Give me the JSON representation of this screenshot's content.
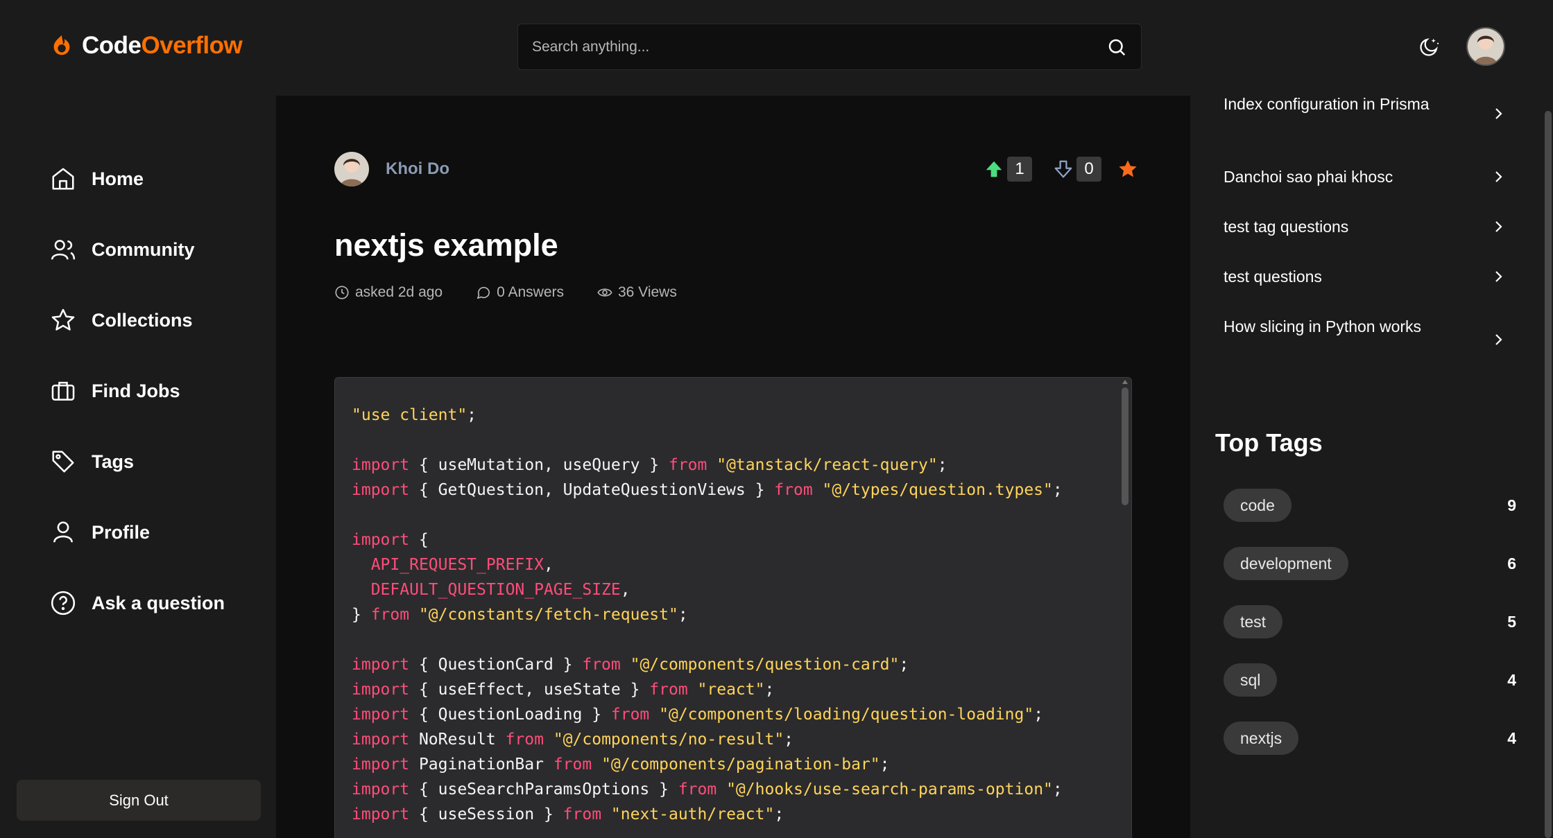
{
  "brand": {
    "name_part1": "Code",
    "name_part2": "Overflow",
    "accent": "#ff7000"
  },
  "search": {
    "placeholder": "Search anything..."
  },
  "sidebar": {
    "items": [
      {
        "label": "Home",
        "icon": "home-icon"
      },
      {
        "label": "Community",
        "icon": "users-icon"
      },
      {
        "label": "Collections",
        "icon": "star-icon"
      },
      {
        "label": "Find Jobs",
        "icon": "briefcase-icon"
      },
      {
        "label": "Tags",
        "icon": "tag-icon"
      },
      {
        "label": "Profile",
        "icon": "user-icon"
      },
      {
        "label": "Ask a question",
        "icon": "question-icon"
      }
    ],
    "signout_label": "Sign Out"
  },
  "question": {
    "author": "Khoi Do",
    "upvotes": "1",
    "downvotes": "0",
    "title": "nextjs example",
    "asked": "asked 2d ago",
    "answers": "0 Answers",
    "views": "36 Views",
    "code_lines": [
      "\"use client\";",
      "",
      "import { useMutation, useQuery } from \"@tanstack/react-query\";",
      "import { GetQuestion, UpdateQuestionViews } from \"@/types/question.types\";",
      "",
      "import {",
      "  API_REQUEST_PREFIX,",
      "  DEFAULT_QUESTION_PAGE_SIZE,",
      "} from \"@/constants/fetch-request\";",
      "",
      "import { QuestionCard } from \"@/components/question-card\";",
      "import { useEffect, useState } from \"react\";",
      "import { QuestionLoading } from \"@/components/loading/question-loading\";",
      "import NoResult from \"@/components/no-result\";",
      "import PaginationBar from \"@/components/pagination-bar\";",
      "import { useSearchParamsOptions } from \"@/hooks/use-search-params-option\";",
      "import { useSession } from \"next-auth/react\";"
    ]
  },
  "hot_questions": [
    "Index configuration in Prisma",
    "Danchoi sao phai khosc",
    "test tag questions",
    "test questions",
    "How slicing in Python works"
  ],
  "top_tags": {
    "title": "Top Tags",
    "items": [
      {
        "name": "code",
        "count": "9"
      },
      {
        "name": "development",
        "count": "6"
      },
      {
        "name": "test",
        "count": "5"
      },
      {
        "name": "sql",
        "count": "4"
      },
      {
        "name": "nextjs",
        "count": "4"
      }
    ]
  },
  "colors": {
    "upvote": "#4ade80",
    "downvote": "#8fa3c7",
    "favorite": "#ff6a1a"
  }
}
